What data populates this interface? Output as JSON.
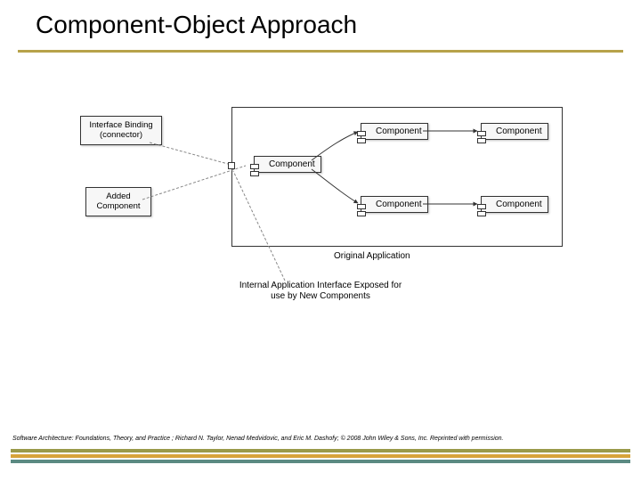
{
  "title": "Component-Object Approach",
  "diagram": {
    "interface_binding_label": "Interface Binding\n(connector)",
    "added_component_label": "Added\nComponent",
    "component_label": "Component",
    "original_application_label": "Original Application",
    "internal_interface_caption": "Internal Application Interface Exposed for\nuse by New Components"
  },
  "footer": "Software Architecture: Foundations, Theory, and Practice ; Richard N. Taylor, Nenad Medvidovic, and Eric M. Dashofy; © 2008 John Wiley & Sons, Inc. Reprinted with permission."
}
